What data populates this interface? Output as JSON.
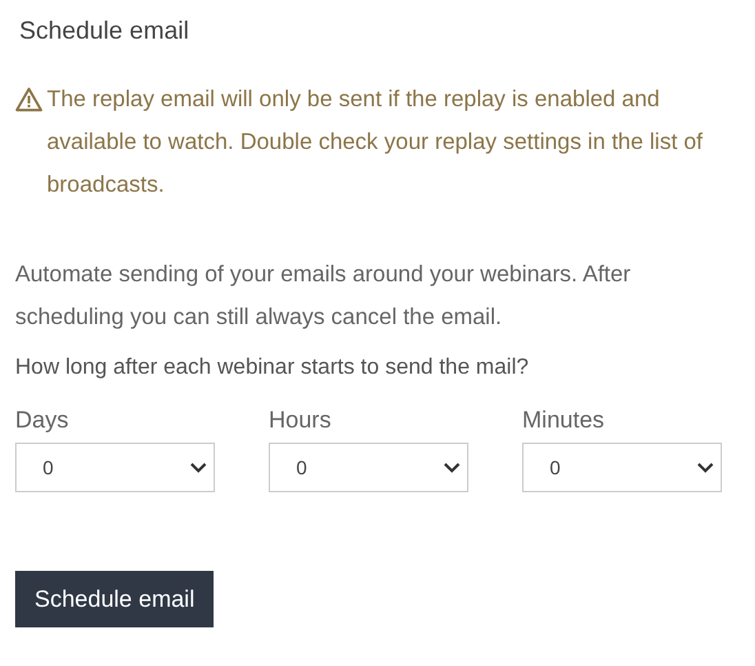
{
  "title": "Schedule email",
  "warning": "The replay email will only be sent if the replay is enabled and available to watch. Double check your replay settings in the list of broadcasts.",
  "description": "Automate sending of your emails around your webinars. After scheduling you can still always cancel the email.",
  "question": "How long after each webinar starts to send the mail?",
  "fields": [
    {
      "label": "Days",
      "value": "0"
    },
    {
      "label": "Hours",
      "value": "0"
    },
    {
      "label": "Minutes",
      "value": "0"
    }
  ],
  "button": "Schedule email"
}
